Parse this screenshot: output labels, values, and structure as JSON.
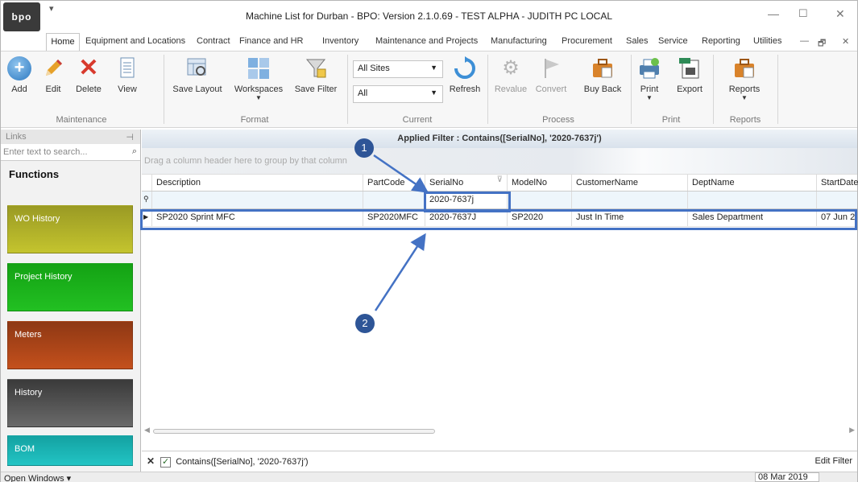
{
  "window": {
    "title": "Machine List for Durban - BPO: Version 2.1.0.69 - TEST ALPHA - JUDITH PC LOCAL",
    "logo_text": "bpo"
  },
  "menu": [
    "Home",
    "Equipment and Locations",
    "Contract",
    "Finance and HR",
    "Inventory",
    "Maintenance and Projects",
    "Manufacturing",
    "Procurement",
    "Sales",
    "Service",
    "Reporting",
    "Utilities"
  ],
  "ribbon": {
    "maintenance": {
      "label": "Maintenance",
      "add": "Add",
      "edit": "Edit",
      "delete": "Delete",
      "view": "View"
    },
    "format": {
      "label": "Format",
      "save_layout": "Save Layout",
      "workspaces": "Workspaces",
      "save_filter": "Save Filter"
    },
    "current": {
      "label": "Current",
      "site_value": "All Sites",
      "filter_value": "All",
      "refresh": "Refresh"
    },
    "process": {
      "label": "Process",
      "revalue": "Revalue",
      "convert": "Convert",
      "buy_back": "Buy Back"
    },
    "print": {
      "label": "Print",
      "print": "Print",
      "export": "Export"
    },
    "reports": {
      "label": "Reports",
      "reports": "Reports"
    }
  },
  "links": {
    "title": "Links",
    "search_placeholder": "Enter text to search...",
    "functions_title": "Functions",
    "tiles": [
      {
        "label": "WO History",
        "color": "#b5b52a"
      },
      {
        "label": "Project History",
        "color": "#1fae1f"
      },
      {
        "label": "Meters",
        "color": "#b4461a"
      },
      {
        "label": "History",
        "color": "#505050"
      },
      {
        "label": "BOM",
        "color": "#1fb4b4"
      }
    ]
  },
  "grid": {
    "applied_filter": "Applied Filter : Contains([SerialNo], '2020-7637j')",
    "group_hint": "Drag a column header here to group by that column",
    "columns": [
      "Description",
      "PartCode",
      "SerialNo",
      "ModelNo",
      "CustomerName",
      "DeptName",
      "StartDate"
    ],
    "filter_value": "2020-7637j",
    "rows": [
      {
        "Description": "SP2020 Sprint MFC",
        "PartCode": "SP2020MFC",
        "SerialNo": "2020-7637J",
        "ModelNo": "SP2020",
        "CustomerName": "Just In Time",
        "DeptName": "Sales Department",
        "StartDate": "07 Jun 2"
      }
    ],
    "filter_panel_text": "Contains([SerialNo], '2020-7637j')",
    "edit_filter": "Edit Filter"
  },
  "status": {
    "open_windows": "Open Windows",
    "date": "08 Mar 2019"
  },
  "annotations": {
    "marker1": "1",
    "marker2": "2",
    "accent": "#4472c4",
    "marker_color": "#2e5597"
  }
}
